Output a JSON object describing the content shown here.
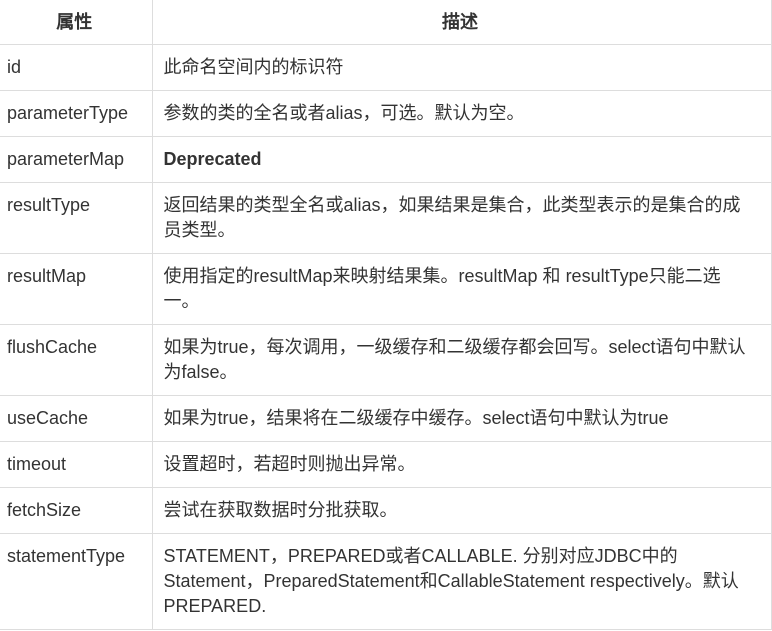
{
  "table": {
    "headers": [
      "属性",
      "描述"
    ],
    "rows": [
      {
        "attribute": "id",
        "description": "此命名空间内的标识符",
        "bold": false
      },
      {
        "attribute": "parameterType",
        "description": "参数的类的全名或者alias，可选。默认为空。",
        "bold": false
      },
      {
        "attribute": "parameterMap",
        "description": "Deprecated",
        "bold": true
      },
      {
        "attribute": "resultType",
        "description": "返回结果的类型全名或alias，如果结果是集合，此类型表示的是集合的成员类型。",
        "bold": false
      },
      {
        "attribute": "resultMap",
        "description": "使用指定的resultMap来映射结果集。resultMap 和 resultType只能二选一。",
        "bold": false
      },
      {
        "attribute": "flushCache",
        "description": "如果为true，每次调用，一级缓存和二级缓存都会回写。select语句中默认为false。",
        "bold": false
      },
      {
        "attribute": "useCache",
        "description": "如果为true，结果将在二级缓存中缓存。select语句中默认为true",
        "bold": false
      },
      {
        "attribute": "timeout",
        "description": "设置超时，若超时则抛出异常。",
        "bold": false
      },
      {
        "attribute": "fetchSize",
        "description": "尝试在获取数据时分批获取。",
        "bold": false
      },
      {
        "attribute": "statementType",
        "description": "STATEMENT，PREPARED或者CALLABLE. 分别对应JDBC中的Statement，PreparedStatement和CallableStatement respectively。默认PREPARED.",
        "bold": false
      }
    ]
  }
}
